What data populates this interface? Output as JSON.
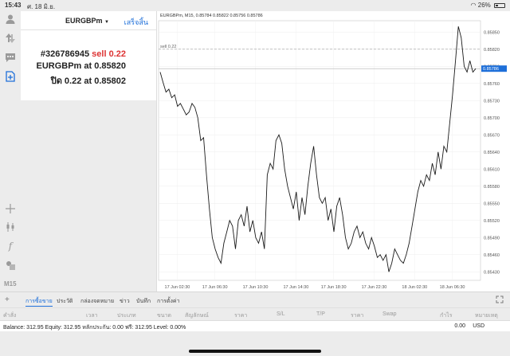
{
  "status_bar": {
    "time": "15:43",
    "date": "ศ. 18 มิ.ย.",
    "battery": "26%"
  },
  "trade_panel": {
    "symbol": "EURGBPm",
    "done_label": "เสร็จสิ้น",
    "order_id": "#326786945",
    "order_side": "sell 0.22",
    "line2_prefix": "EURGBPm at ",
    "line2_price": "0.85820",
    "line3_prefix": "ปิด 0.22 at ",
    "line3_price": "0.85802"
  },
  "timeframe": "M15",
  "chart": {
    "header": "EURGBPm, M15, 0.85784 0.85822 0.85756 0.85786",
    "order_line_label": "sell 0.22",
    "current_price_label": "0.85786",
    "line_color": "#1a1a1a",
    "price_tag_color": "#1e6fd9"
  },
  "chart_data": {
    "type": "line",
    "title": "EURGBPm, M15, 0.85784 0.85822 0.85756 0.85786",
    "y_ticks": [
      "0.85850",
      "0.85820",
      "0.85790",
      "0.85760",
      "0.85730",
      "0.85700",
      "0.85670",
      "0.85640",
      "0.85610",
      "0.85580",
      "0.85550",
      "0.85520",
      "0.85490",
      "0.85460",
      "0.85430"
    ],
    "x_ticks": [
      "17 Jun 02:30",
      "17 Jun 06:30",
      "17 Jun 10:30",
      "17 Jun 14:30",
      "17 Jun 18:30",
      "17 Jun 22:30",
      "18 Jun 02:30",
      "18 Jun 06:30"
    ],
    "ylim": [
      0.85415,
      0.8587
    ],
    "order_line": 0.8582,
    "current_price": 0.85786,
    "grid": true,
    "values": [
      0.8578,
      0.85762,
      0.85745,
      0.8575,
      0.85735,
      0.8574,
      0.8572,
      0.85725,
      0.85715,
      0.85705,
      0.8571,
      0.85725,
      0.85718,
      0.857,
      0.8566,
      0.85665,
      0.856,
      0.8554,
      0.8549,
      0.8547,
      0.85455,
      0.85445,
      0.8548,
      0.855,
      0.8552,
      0.8551,
      0.8547,
      0.8552,
      0.8553,
      0.8551,
      0.85545,
      0.855,
      0.8552,
      0.8549,
      0.8548,
      0.855,
      0.8547,
      0.856,
      0.8562,
      0.8561,
      0.8566,
      0.8567,
      0.85655,
      0.8561,
      0.8558,
      0.8556,
      0.8554,
      0.8557,
      0.8552,
      0.8556,
      0.8553,
      0.8558,
      0.8562,
      0.8565,
      0.856,
      0.8556,
      0.8555,
      0.8556,
      0.8552,
      0.8554,
      0.855,
      0.85545,
      0.8556,
      0.8553,
      0.8549,
      0.8547,
      0.8548,
      0.855,
      0.8551,
      0.8549,
      0.855,
      0.8548,
      0.8547,
      0.8549,
      0.85475,
      0.85455,
      0.8546,
      0.8545,
      0.8546,
      0.8543,
      0.85445,
      0.8547,
      0.8546,
      0.8545,
      0.85445,
      0.8546,
      0.8548,
      0.8551,
      0.8554,
      0.8557,
      0.8559,
      0.8558,
      0.856,
      0.8559,
      0.8562,
      0.856,
      0.8564,
      0.8561,
      0.8565,
      0.8564,
      0.8569,
      0.8574,
      0.858,
      0.8586,
      0.8584,
      0.8579,
      0.8578,
      0.858,
      0.8578,
      0.85786
    ]
  },
  "bottom_tabs": [
    "การซื้อขาย",
    "ประวัติ",
    "กล่องจดหมาย",
    "ข่าว",
    "บันทึก",
    "การตั้งค่า"
  ],
  "columns": [
    "คำสั่ง",
    "เวลา",
    "ประเภท",
    "ขนาด",
    "สัญลักษณ์",
    "ราคา",
    "S/L",
    "T/P",
    "ราคา",
    "Swap",
    "กำไร",
    "หมายเหตุ"
  ],
  "balance_line": "Balance: 312.95 Equity: 312.95 หลักประกัน: 0.00 ฟรี: 312.95 Level: 0.00%",
  "total": "0.00",
  "currency": "USD"
}
